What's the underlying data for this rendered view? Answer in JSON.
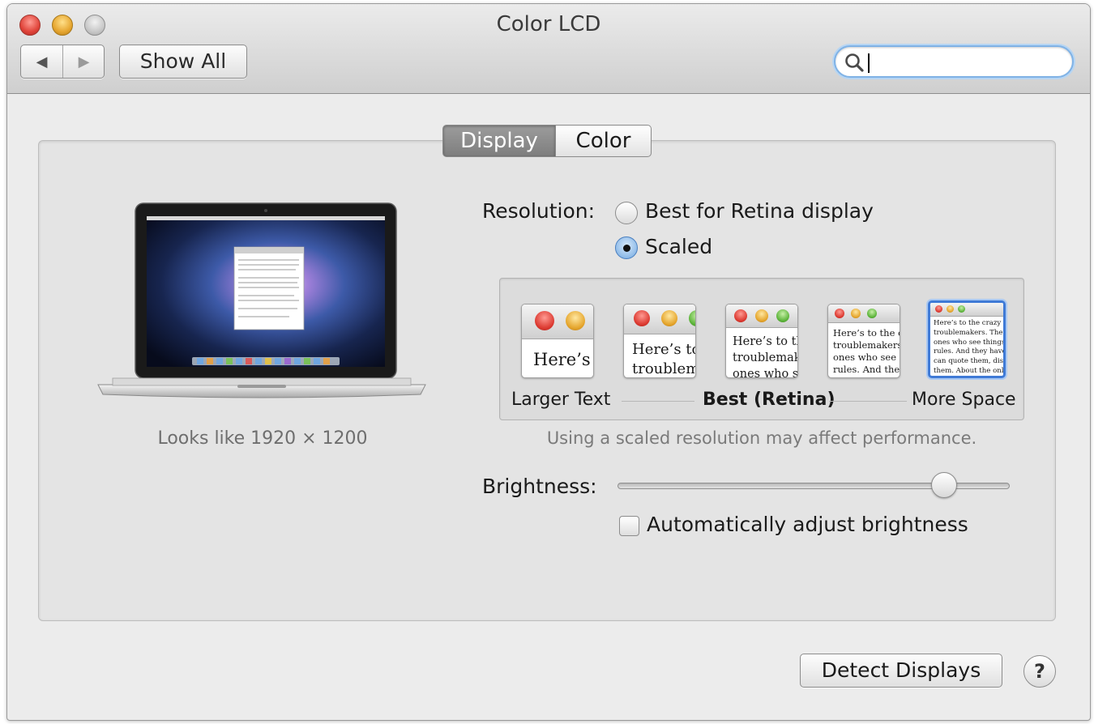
{
  "window": {
    "title": "Color LCD"
  },
  "toolbar": {
    "back_glyph": "◀",
    "forward_glyph": "▶",
    "show_all_label": "Show All",
    "search": {
      "value": "",
      "placeholder": ""
    }
  },
  "tabs": [
    {
      "label": "Display",
      "selected": true
    },
    {
      "label": "Color",
      "selected": false
    }
  ],
  "display_preview": {
    "caption": "Looks like 1920 × 1200"
  },
  "resolution": {
    "label": "Resolution:",
    "options": [
      {
        "label": "Best for Retina display",
        "selected": false
      },
      {
        "label": "Scaled",
        "selected": true
      }
    ]
  },
  "scaling": {
    "thumbnails": [
      {
        "text": "Here’s",
        "selected": false
      },
      {
        "text": "Here’s to\ntroublem",
        "selected": false
      },
      {
        "text": "Here’s to th\ntroublemak\nones who s",
        "selected": false
      },
      {
        "text": "Here’s to the cr\ntroublemakers.\nones who see t\nrules. And they",
        "selected": false
      },
      {
        "text": "Here’s to the crazy ones\ntroublemakers. The rou\nones who see things di\nrules. And they have no\ncan quote them, disagre\nthem. About the only th\nBecause they change th",
        "selected": true
      }
    ],
    "labels": {
      "left": "Larger Text",
      "middle": "Best (Retina)",
      "right": "More Space"
    },
    "note": "Using a scaled resolution may affect performance."
  },
  "brightness": {
    "label": "Brightness:",
    "level": 0.86,
    "auto_label": "Automatically adjust brightness",
    "auto_checked": false
  },
  "footer": {
    "detect_label": "Detect Displays",
    "help_label": "?"
  },
  "colors": {
    "accent": "#3f7ad6",
    "focus_ring": "#7fb2e6"
  }
}
